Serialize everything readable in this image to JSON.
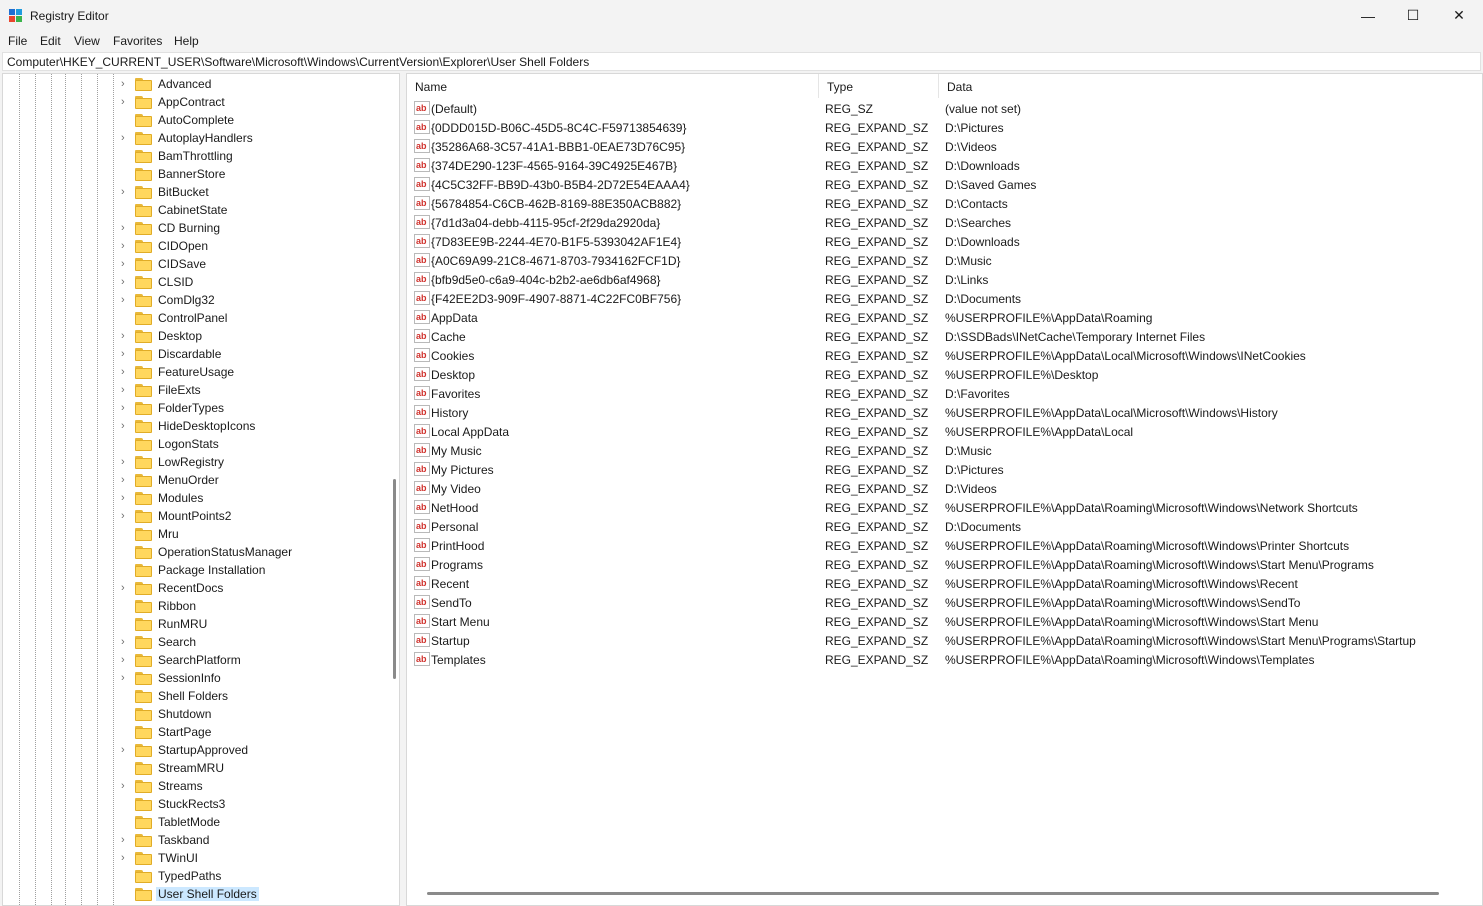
{
  "window": {
    "title": "Registry Editor",
    "minimize": "—",
    "maximize": "☐",
    "close": "✕",
    "icon_colors": [
      "#1f6fd1",
      "#1f9bde",
      "#e9462e",
      "#3bb44a"
    ]
  },
  "menu": [
    "File",
    "Edit",
    "View",
    "Favorites",
    "Help"
  ],
  "address": "Computer\\HKEY_CURRENT_USER\\Software\\Microsoft\\Windows\\CurrentVersion\\Explorer\\User Shell Folders",
  "tree": {
    "items": [
      {
        "label": "Advanced",
        "expandable": true
      },
      {
        "label": "AppContract",
        "expandable": true
      },
      {
        "label": "AutoComplete",
        "expandable": false
      },
      {
        "label": "AutoplayHandlers",
        "expandable": true
      },
      {
        "label": "BamThrottling",
        "expandable": false
      },
      {
        "label": "BannerStore",
        "expandable": false
      },
      {
        "label": "BitBucket",
        "expandable": true
      },
      {
        "label": "CabinetState",
        "expandable": false
      },
      {
        "label": "CD Burning",
        "expandable": true
      },
      {
        "label": "CIDOpen",
        "expandable": true
      },
      {
        "label": "CIDSave",
        "expandable": true
      },
      {
        "label": "CLSID",
        "expandable": true
      },
      {
        "label": "ComDlg32",
        "expandable": true
      },
      {
        "label": "ControlPanel",
        "expandable": false
      },
      {
        "label": "Desktop",
        "expandable": true
      },
      {
        "label": "Discardable",
        "expandable": true
      },
      {
        "label": "FeatureUsage",
        "expandable": true
      },
      {
        "label": "FileExts",
        "expandable": true
      },
      {
        "label": "FolderTypes",
        "expandable": true
      },
      {
        "label": "HideDesktopIcons",
        "expandable": true
      },
      {
        "label": "LogonStats",
        "expandable": false
      },
      {
        "label": "LowRegistry",
        "expandable": true
      },
      {
        "label": "MenuOrder",
        "expandable": true
      },
      {
        "label": "Modules",
        "expandable": true
      },
      {
        "label": "MountPoints2",
        "expandable": true
      },
      {
        "label": "Mru",
        "expandable": false
      },
      {
        "label": "OperationStatusManager",
        "expandable": false
      },
      {
        "label": "Package Installation",
        "expandable": false
      },
      {
        "label": "RecentDocs",
        "expandable": true
      },
      {
        "label": "Ribbon",
        "expandable": false
      },
      {
        "label": "RunMRU",
        "expandable": false
      },
      {
        "label": "Search",
        "expandable": true
      },
      {
        "label": "SearchPlatform",
        "expandable": true
      },
      {
        "label": "SessionInfo",
        "expandable": true
      },
      {
        "label": "Shell Folders",
        "expandable": false
      },
      {
        "label": "Shutdown",
        "expandable": false
      },
      {
        "label": "StartPage",
        "expandable": false
      },
      {
        "label": "StartupApproved",
        "expandable": true
      },
      {
        "label": "StreamMRU",
        "expandable": false
      },
      {
        "label": "Streams",
        "expandable": true
      },
      {
        "label": "StuckRects3",
        "expandable": false
      },
      {
        "label": "TabletMode",
        "expandable": false
      },
      {
        "label": "Taskband",
        "expandable": true
      },
      {
        "label": "TWinUI",
        "expandable": true
      },
      {
        "label": "TypedPaths",
        "expandable": false
      },
      {
        "label": "User Shell Folders",
        "expandable": false,
        "selected": true
      }
    ]
  },
  "list": {
    "columns": [
      "Name",
      "Type",
      "Data"
    ],
    "rows": [
      {
        "name": "(Default)",
        "type": "REG_SZ",
        "data": "(value not set)"
      },
      {
        "name": "{0DDD015D-B06C-45D5-8C4C-F59713854639}",
        "type": "REG_EXPAND_SZ",
        "data": "D:\\Pictures"
      },
      {
        "name": "{35286A68-3C57-41A1-BBB1-0EAE73D76C95}",
        "type": "REG_EXPAND_SZ",
        "data": "D:\\Videos"
      },
      {
        "name": "{374DE290-123F-4565-9164-39C4925E467B}",
        "type": "REG_EXPAND_SZ",
        "data": "D:\\Downloads"
      },
      {
        "name": "{4C5C32FF-BB9D-43b0-B5B4-2D72E54EAAA4}",
        "type": "REG_EXPAND_SZ",
        "data": "D:\\Saved Games"
      },
      {
        "name": "{56784854-C6CB-462B-8169-88E350ACB882}",
        "type": "REG_EXPAND_SZ",
        "data": "D:\\Contacts"
      },
      {
        "name": "{7d1d3a04-debb-4115-95cf-2f29da2920da}",
        "type": "REG_EXPAND_SZ",
        "data": "D:\\Searches"
      },
      {
        "name": "{7D83EE9B-2244-4E70-B1F5-5393042AF1E4}",
        "type": "REG_EXPAND_SZ",
        "data": "D:\\Downloads"
      },
      {
        "name": "{A0C69A99-21C8-4671-8703-7934162FCF1D}",
        "type": "REG_EXPAND_SZ",
        "data": "D:\\Music"
      },
      {
        "name": "{bfb9d5e0-c6a9-404c-b2b2-ae6db6af4968}",
        "type": "REG_EXPAND_SZ",
        "data": "D:\\Links"
      },
      {
        "name": "{F42EE2D3-909F-4907-8871-4C22FC0BF756}",
        "type": "REG_EXPAND_SZ",
        "data": "D:\\Documents"
      },
      {
        "name": "AppData",
        "type": "REG_EXPAND_SZ",
        "data": "%USERPROFILE%\\AppData\\Roaming"
      },
      {
        "name": "Cache",
        "type": "REG_EXPAND_SZ",
        "data": "D:\\SSDBads\\INetCache\\Temporary Internet Files"
      },
      {
        "name": "Cookies",
        "type": "REG_EXPAND_SZ",
        "data": "%USERPROFILE%\\AppData\\Local\\Microsoft\\Windows\\INetCookies"
      },
      {
        "name": "Desktop",
        "type": "REG_EXPAND_SZ",
        "data": "%USERPROFILE%\\Desktop"
      },
      {
        "name": "Favorites",
        "type": "REG_EXPAND_SZ",
        "data": "D:\\Favorites"
      },
      {
        "name": "History",
        "type": "REG_EXPAND_SZ",
        "data": "%USERPROFILE%\\AppData\\Local\\Microsoft\\Windows\\History"
      },
      {
        "name": "Local AppData",
        "type": "REG_EXPAND_SZ",
        "data": "%USERPROFILE%\\AppData\\Local"
      },
      {
        "name": "My Music",
        "type": "REG_EXPAND_SZ",
        "data": "D:\\Music"
      },
      {
        "name": "My Pictures",
        "type": "REG_EXPAND_SZ",
        "data": "D:\\Pictures"
      },
      {
        "name": "My Video",
        "type": "REG_EXPAND_SZ",
        "data": "D:\\Videos"
      },
      {
        "name": "NetHood",
        "type": "REG_EXPAND_SZ",
        "data": "%USERPROFILE%\\AppData\\Roaming\\Microsoft\\Windows\\Network Shortcuts"
      },
      {
        "name": "Personal",
        "type": "REG_EXPAND_SZ",
        "data": "D:\\Documents"
      },
      {
        "name": "PrintHood",
        "type": "REG_EXPAND_SZ",
        "data": "%USERPROFILE%\\AppData\\Roaming\\Microsoft\\Windows\\Printer Shortcuts"
      },
      {
        "name": "Programs",
        "type": "REG_EXPAND_SZ",
        "data": "%USERPROFILE%\\AppData\\Roaming\\Microsoft\\Windows\\Start Menu\\Programs"
      },
      {
        "name": "Recent",
        "type": "REG_EXPAND_SZ",
        "data": "%USERPROFILE%\\AppData\\Roaming\\Microsoft\\Windows\\Recent"
      },
      {
        "name": "SendTo",
        "type": "REG_EXPAND_SZ",
        "data": "%USERPROFILE%\\AppData\\Roaming\\Microsoft\\Windows\\SendTo"
      },
      {
        "name": "Start Menu",
        "type": "REG_EXPAND_SZ",
        "data": "%USERPROFILE%\\AppData\\Roaming\\Microsoft\\Windows\\Start Menu"
      },
      {
        "name": "Startup",
        "type": "REG_EXPAND_SZ",
        "data": "%USERPROFILE%\\AppData\\Roaming\\Microsoft\\Windows\\Start Menu\\Programs\\Startup"
      },
      {
        "name": "Templates",
        "type": "REG_EXPAND_SZ",
        "data": "%USERPROFILE%\\AppData\\Roaming\\Microsoft\\Windows\\Templates"
      }
    ],
    "value_icon": "ab"
  }
}
